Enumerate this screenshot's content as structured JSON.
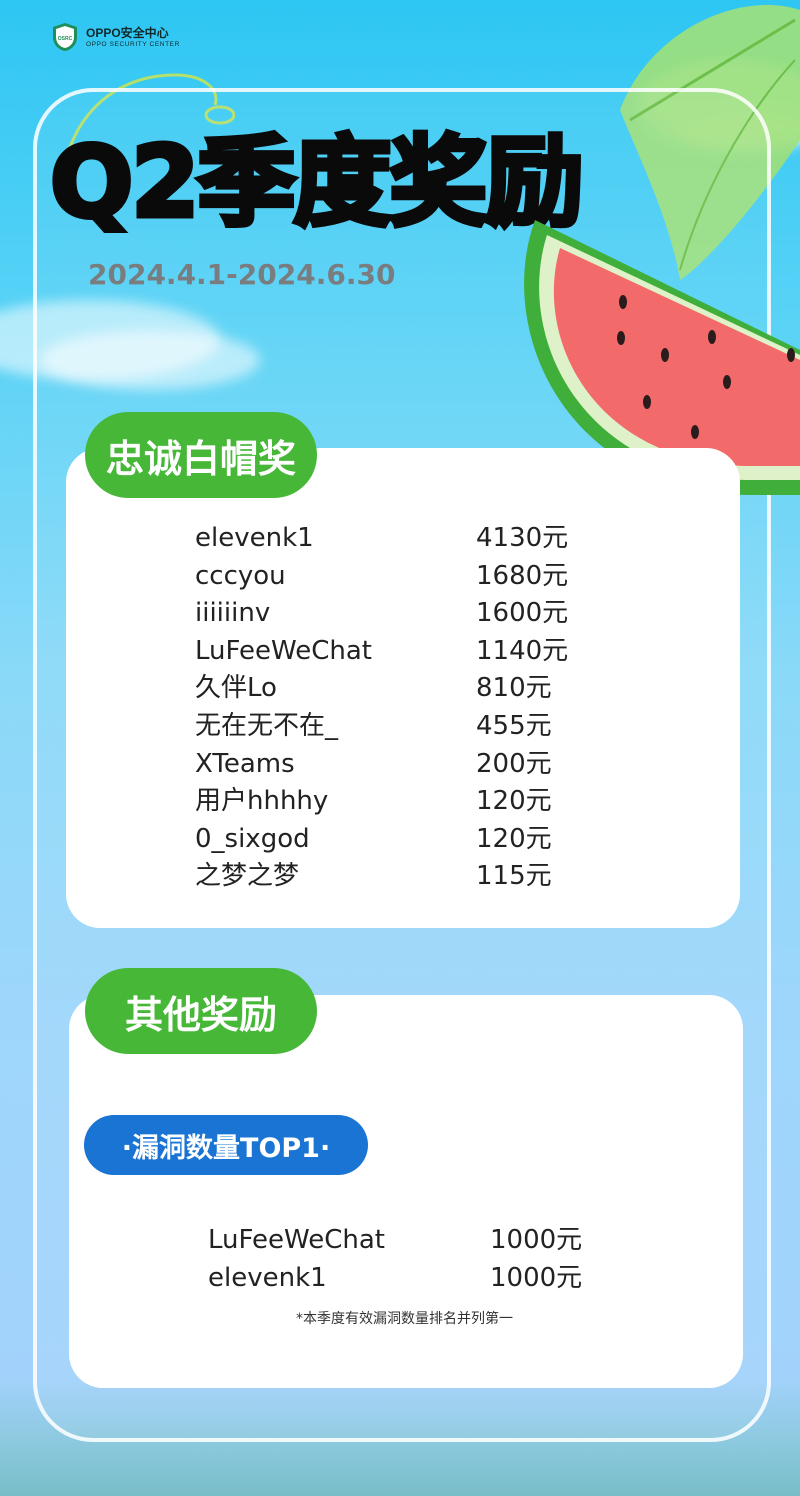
{
  "brand": {
    "name_cn": "OPPO安全中心",
    "name_en": "OPPO SECURITY CENTER",
    "badge": "OSRC"
  },
  "header": {
    "title": "Q2季度奖励",
    "date_range": "2024.4.1-2024.6.30"
  },
  "loyal_award": {
    "label": "忠诚白帽奖",
    "rows": [
      {
        "name": "elevenk1",
        "amount": "4130元"
      },
      {
        "name": "cccyou",
        "amount": "1680元"
      },
      {
        "name": "iiiiiinv",
        "amount": "1600元"
      },
      {
        "name": "LuFeeWeChat",
        "amount": "1140元"
      },
      {
        "name": "久伴Lo",
        "amount": "810元"
      },
      {
        "name": "无在无不在_",
        "amount": "455元"
      },
      {
        "name": "XTeams",
        "amount": "200元"
      },
      {
        "name": "用户hhhhy",
        "amount": "120元"
      },
      {
        "name": "0_sixgod",
        "amount": "120元"
      },
      {
        "name": "之梦之梦",
        "amount": "115元"
      }
    ]
  },
  "other_awards": {
    "label": "其他奖励",
    "sub_label": "·漏洞数量TOP1·",
    "rows": [
      {
        "name": "LuFeeWeChat",
        "amount": "1000元"
      },
      {
        "name": "elevenk1",
        "amount": "1000元"
      }
    ],
    "note": "*本季度有效漏洞数量排名并列第一"
  },
  "colors": {
    "green_pill": "#46b737",
    "blue_pill": "#1a74d4",
    "title": "#0a0a0a",
    "date": "#7a7d80"
  }
}
